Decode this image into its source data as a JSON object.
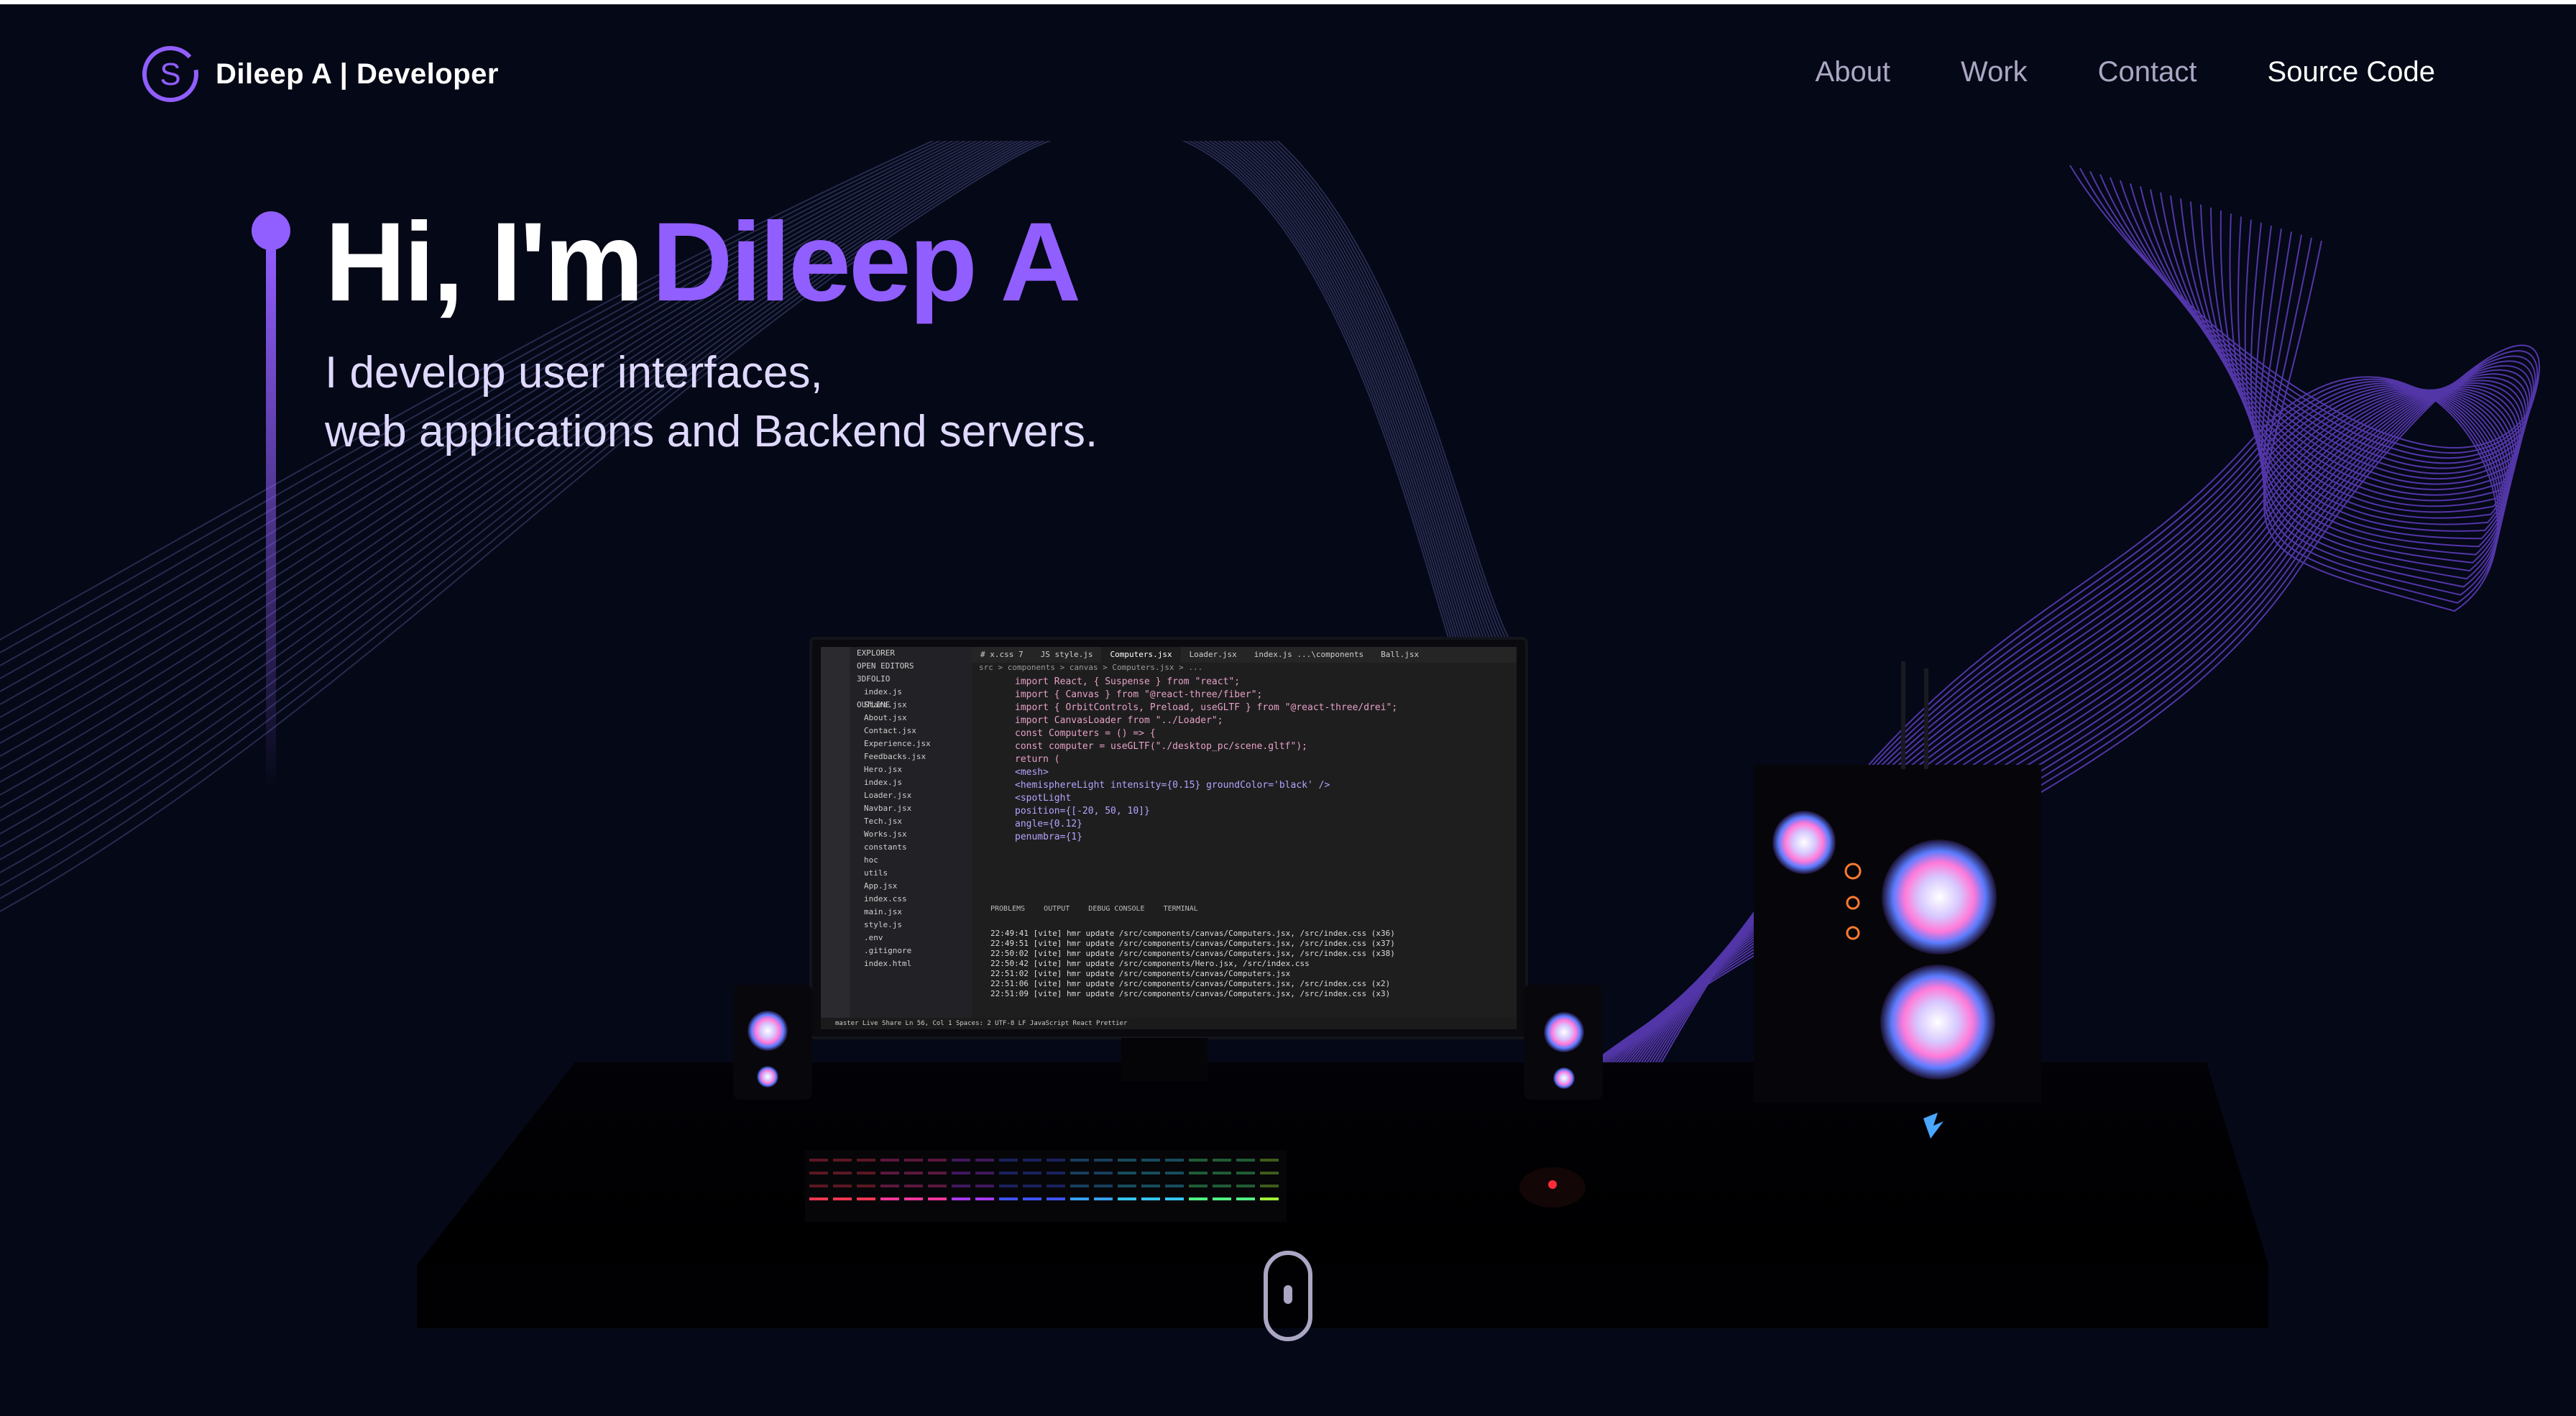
{
  "colors": {
    "background": "#050816",
    "accent": "#915eff",
    "nav_text": "#aaa6c3",
    "subtitle": "#dfd9ff"
  },
  "navbar": {
    "logo_icon": "s-logo-icon",
    "brand": "Dileep A | Developer",
    "links": [
      "About",
      "Work",
      "Contact",
      "Source Code"
    ]
  },
  "hero": {
    "greeting": "Hi, I'm",
    "name": "Dileep A",
    "subtitle_line1": "I develop user interfaces,",
    "subtitle_line2": "web applications and Backend servers."
  },
  "editor": {
    "explorer_title": "EXPLORER",
    "open_editors": "OPEN EDITORS",
    "folder": "3DFOLIO",
    "files": [
      "index.js",
      "Stars.jsx",
      "About.jsx",
      "Contact.jsx",
      "Experience.jsx",
      "Feedbacks.jsx",
      "Hero.jsx",
      "index.js",
      "Loader.jsx",
      "Navbar.jsx",
      "Tech.jsx",
      "Works.jsx",
      "constants",
      "hoc",
      "utils",
      "App.jsx",
      "index.css",
      "main.jsx",
      "style.js",
      ".env",
      ".gitignore",
      "index.html"
    ],
    "outline": "OUTLINE",
    "tabs": [
      "# x.css 7",
      "JS style.js",
      "Computers.jsx",
      "Loader.jsx",
      "index.js ...\\components",
      "Ball.jsx"
    ],
    "breadcrumb": "src > components > canvas > Computers.jsx > ...",
    "code": [
      "import React, { Suspense } from \"react\";",
      "import { Canvas } from \"@react-three/fiber\";",
      "import { OrbitControls, Preload, useGLTF } from \"@react-three/drei\";",
      "",
      "import CanvasLoader from \"../Loader\";",
      "",
      "const Computers = () => {",
      "  const computer = useGLTF(\"./desktop_pc/scene.gltf\");",
      "",
      "  return (",
      "    <mesh>",
      "      <hemisphereLight intensity={0.15} groundColor='black' />",
      "      <spotLight",
      "        position={[-20, 50, 10]}",
      "        angle={0.12}",
      "        penumbra={1}"
    ],
    "panel_tabs": [
      "PROBLEMS",
      "OUTPUT",
      "DEBUG CONSOLE",
      "TERMINAL"
    ],
    "terminal": [
      "22:49:41 [vite] hmr update /src/components/canvas/Computers.jsx, /src/index.css (x36)",
      "22:49:51 [vite] hmr update /src/components/canvas/Computers.jsx, /src/index.css (x37)",
      "22:50:02 [vite] hmr update /src/components/canvas/Computers.jsx, /src/index.css (x38)",
      "22:50:42 [vite] hmr update /src/components/Hero.jsx, /src/index.css",
      "22:51:02 [vite] hmr update /src/components/canvas/Computers.jsx",
      "22:51:06 [vite] hmr update /src/components/canvas/Computers.jsx, /src/index.css (x2)",
      "22:51:09 [vite] hmr update /src/components/canvas/Computers.jsx, /src/index.css (x3)"
    ],
    "status": "master   Live Share        Ln 56, Col 1   Spaces: 2   UTF-8   LF   JavaScript React   Prettier"
  },
  "scroll_hint_icon": "mouse-scroll-icon"
}
